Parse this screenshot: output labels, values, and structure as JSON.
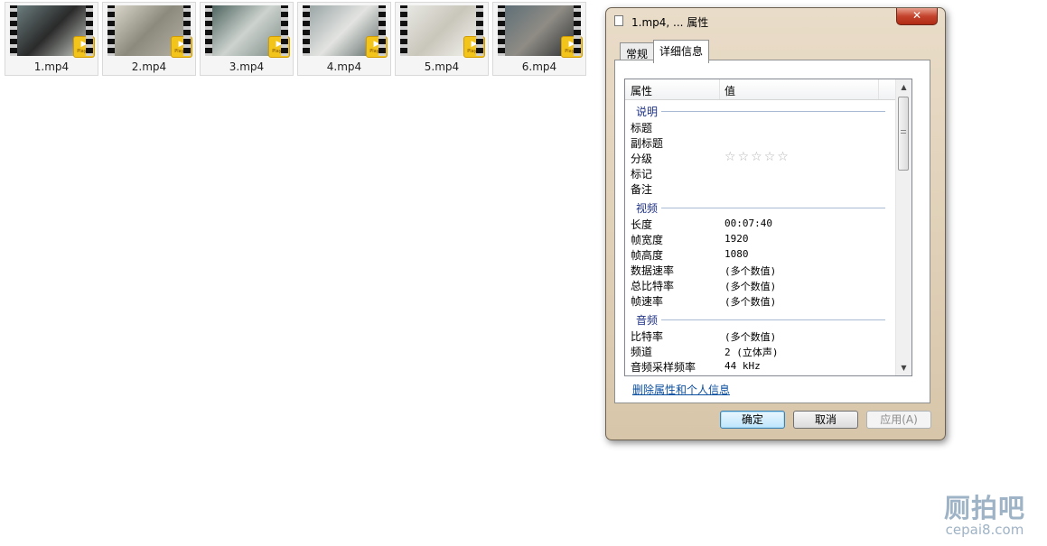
{
  "thumbnails": [
    {
      "label": "1.mp4",
      "badge": "Player",
      "tone": [
        "#6c7d7e",
        "#2a2a2a",
        "#c7ccc5"
      ]
    },
    {
      "label": "2.mp4",
      "badge": "Player",
      "tone": [
        "#d8d4c9",
        "#8c8a7d",
        "#b5b2a4"
      ]
    },
    {
      "label": "3.mp4",
      "badge": "Player",
      "tone": [
        "#4f6560",
        "#cdd3cf",
        "#7d8c86"
      ]
    },
    {
      "label": "4.mp4",
      "badge": "Player",
      "tone": [
        "#9ba6a6",
        "#e3e4e1",
        "#5d6a68"
      ]
    },
    {
      "label": "5.mp4",
      "badge": "Player",
      "tone": [
        "#e7e7e2",
        "#c9c6bb",
        "#f3f3ef"
      ]
    },
    {
      "label": "6.mp4",
      "badge": "Player",
      "tone": [
        "#5f6f77",
        "#8f8c85",
        "#2e3133"
      ]
    }
  ],
  "dialog": {
    "title": "1.mp4, ... 属性",
    "close_symbol": "✕",
    "tabs": [
      {
        "label": "常规",
        "active": false
      },
      {
        "label": "详细信息",
        "active": true
      }
    ],
    "columns": {
      "property": "属性",
      "value": "值"
    },
    "sections": [
      {
        "name": "说明",
        "rows": [
          {
            "property": "标题",
            "value": ""
          },
          {
            "property": "副标题",
            "value": ""
          },
          {
            "property": "分级",
            "rating": 0
          },
          {
            "property": "标记",
            "value": ""
          },
          {
            "property": "备注",
            "value": ""
          }
        ]
      },
      {
        "name": "视频",
        "rows": [
          {
            "property": "长度",
            "value": "00:07:40"
          },
          {
            "property": "帧宽度",
            "value": "1920"
          },
          {
            "property": "帧高度",
            "value": "1080"
          },
          {
            "property": "数据速率",
            "value": "(多个数值)"
          },
          {
            "property": "总比特率",
            "value": "(多个数值)"
          },
          {
            "property": "帧速率",
            "value": "(多个数值)"
          }
        ]
      },
      {
        "name": "音频",
        "rows": [
          {
            "property": "比特率",
            "value": "(多个数值)"
          },
          {
            "property": "频道",
            "value": "2 (立体声)"
          },
          {
            "property": "音频采样频率",
            "value": "44 kHz"
          }
        ]
      }
    ],
    "remove_link": "删除属性和个人信息",
    "buttons": {
      "ok": "确定",
      "cancel": "取消",
      "apply": "应用(A)"
    }
  },
  "watermark": {
    "cn": "厕拍吧",
    "en": "cepai8.com"
  }
}
